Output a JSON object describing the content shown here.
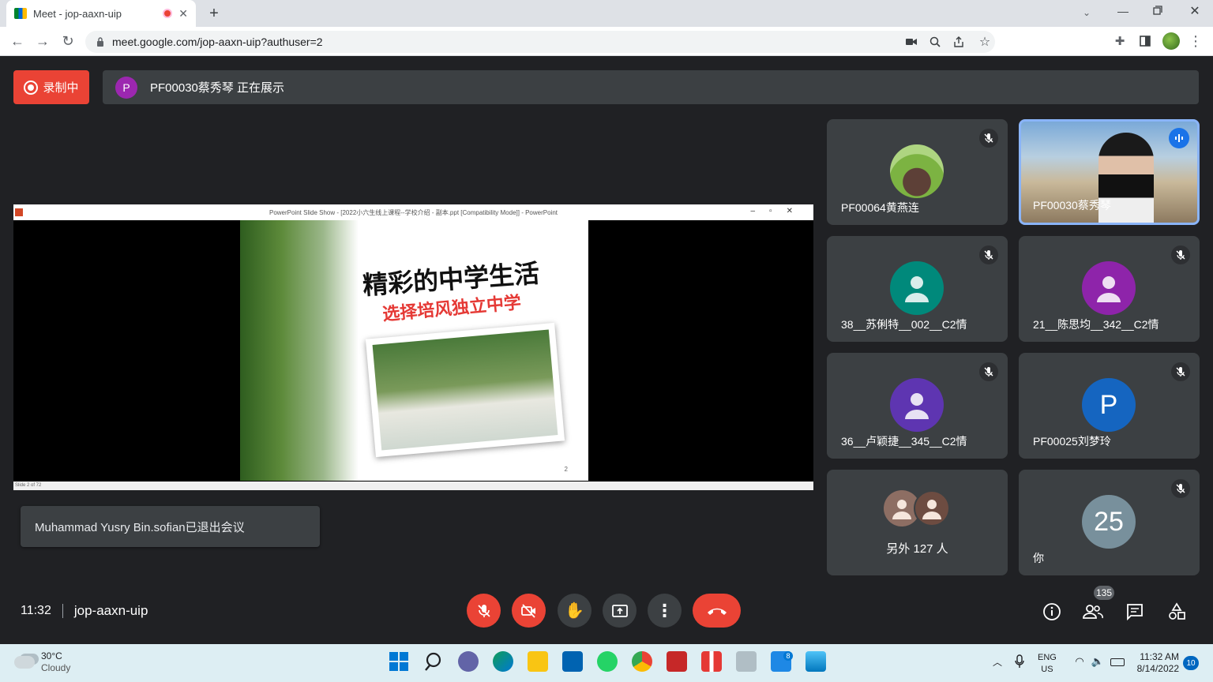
{
  "browser": {
    "tab_title": "Meet - jop-aaxn-uip",
    "url": "meet.google.com/jop-aaxn-uip?authuser=2"
  },
  "meet": {
    "recording_label": "录制中",
    "presenter_initial": "P",
    "presenting_text": "PF00030蔡秀琴 正在展示",
    "ppt_title": "PowerPoint Slide Show - [2022小六生线上课程--学校介绍 - 副本.ppt [Compatibility Mode]] - PowerPoint",
    "ppt_status": "Slide 2 of 72",
    "slide_title": "精彩的中学生活",
    "slide_subtitle": "选择培风独立中学",
    "slide_number": "2",
    "toast": "Muhammad Yusry Bin.sofian已退出会议",
    "clock": "11:32",
    "meeting_code": "jop-aaxn-uip",
    "participants_count": "135",
    "tiles": [
      {
        "name": "PF00064黄燕连",
        "avatar_color": "#7cb342"
      },
      {
        "name": "PF00030蔡秀琴"
      },
      {
        "name": "38__苏俐特__002__C2情",
        "avatar_color": "#00897b"
      },
      {
        "name": "21__陈思均__342__C2情",
        "avatar_color": "#8e24aa"
      },
      {
        "name": "36__卢颖捷__345__C2情",
        "avatar_color": "#5e35b1"
      },
      {
        "name": "PF00025刘梦玲",
        "initial": "P",
        "avatar_color": "#1565c0"
      },
      {
        "name": "另外 127 人"
      },
      {
        "name": "你",
        "initial": "25",
        "avatar_color": "#78909c"
      }
    ]
  },
  "taskbar": {
    "weather_temp": "30°C",
    "weather_desc": "Cloudy",
    "lang1": "ENG",
    "lang2": "US",
    "time": "11:32 AM",
    "date": "8/14/2022",
    "notif_count": "10",
    "mail_badge": "8"
  }
}
